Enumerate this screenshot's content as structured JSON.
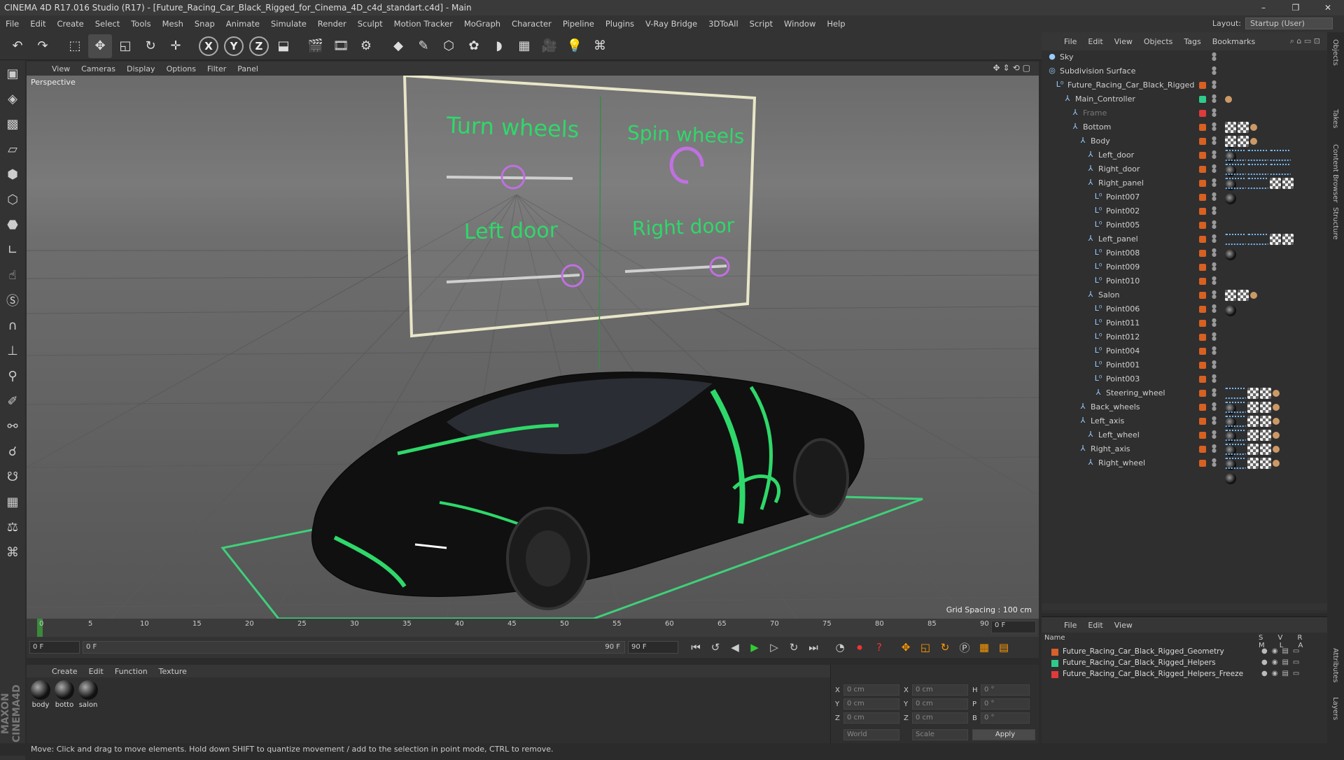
{
  "window": {
    "title": "CINEMA 4D R17.016 Studio (R17) - [Future_Racing_Car_Black_Rigged_for_Cinema_4D_c4d_standart.c4d] - Main"
  },
  "menu": [
    "File",
    "Edit",
    "Create",
    "Select",
    "Tools",
    "Mesh",
    "Snap",
    "Animate",
    "Simulate",
    "Render",
    "Sculpt",
    "Motion Tracker",
    "MoGraph",
    "Character",
    "Pipeline",
    "Plugins",
    "V-Ray Bridge",
    "3DToAll",
    "Script",
    "Window",
    "Help"
  ],
  "layout": {
    "label": "Layout:",
    "value": "Startup (User)"
  },
  "viewport": {
    "menu": [
      "View",
      "Cameras",
      "Display",
      "Options",
      "Filter",
      "Panel"
    ],
    "camera_label": "Perspective",
    "grid_spacing": "Grid Spacing : 100 cm",
    "hud": {
      "turn": "Turn wheels",
      "spin": "Spin wheels",
      "left": "Left door",
      "right": "Right door"
    }
  },
  "timeline": {
    "ticks": [
      "0",
      "5",
      "10",
      "15",
      "20",
      "25",
      "30",
      "35",
      "40",
      "45",
      "50",
      "55",
      "60",
      "65",
      "70",
      "75",
      "80",
      "85",
      "90"
    ],
    "current_frame": "0 F"
  },
  "transport": {
    "start": "0 F",
    "range_start": "0 F",
    "range_end": "90 F",
    "end": "90 F"
  },
  "material_panel": {
    "menu": [
      "Create",
      "Edit",
      "Function",
      "Texture"
    ],
    "materials": [
      "body",
      "botto",
      "salon"
    ]
  },
  "coordinates": {
    "x_pos": "0 cm",
    "y_pos": "0 cm",
    "z_pos": "0 cm",
    "x_size": "0 cm",
    "y_size": "0 cm",
    "z_size": "0 cm",
    "h": "0 °",
    "p": "0 °",
    "b": "0 °",
    "mode": "World",
    "scale": "Scale",
    "apply": "Apply"
  },
  "status": "Move: Click and drag to move elements. Hold down SHIFT to quantize movement / add to the selection in point mode, CTRL to remove.",
  "object_manager": {
    "menu": [
      "File",
      "Edit",
      "View",
      "Objects",
      "Tags",
      "Bookmarks"
    ],
    "objects": [
      {
        "name": "Sky",
        "depth": 0,
        "icon": "sky"
      },
      {
        "name": "Subdivision Surface",
        "depth": 0,
        "icon": "subdiv"
      },
      {
        "name": "Future_Racing_Car_Black_Rigged",
        "depth": 1,
        "icon": "null"
      },
      {
        "name": "Main_Controller",
        "depth": 2,
        "icon": "joint"
      },
      {
        "name": "Frame",
        "depth": 3,
        "icon": "spline"
      },
      {
        "name": "Bottom",
        "depth": 3,
        "icon": "joint"
      },
      {
        "name": "Body",
        "depth": 4,
        "icon": "joint"
      },
      {
        "name": "Left_door",
        "depth": 5,
        "icon": "joint"
      },
      {
        "name": "Right_door",
        "depth": 5,
        "icon": "joint"
      },
      {
        "name": "Right_panel",
        "depth": 5,
        "icon": "joint"
      },
      {
        "name": "Point007",
        "depth": 6,
        "icon": "null"
      },
      {
        "name": "Point002",
        "depth": 6,
        "icon": "null"
      },
      {
        "name": "Point005",
        "depth": 6,
        "icon": "null"
      },
      {
        "name": "Left_panel",
        "depth": 5,
        "icon": "joint"
      },
      {
        "name": "Point008",
        "depth": 6,
        "icon": "null"
      },
      {
        "name": "Point009",
        "depth": 6,
        "icon": "null"
      },
      {
        "name": "Point010",
        "depth": 6,
        "icon": "null"
      },
      {
        "name": "Salon",
        "depth": 5,
        "icon": "joint"
      },
      {
        "name": "Point006",
        "depth": 6,
        "icon": "null"
      },
      {
        "name": "Point011",
        "depth": 6,
        "icon": "null"
      },
      {
        "name": "Point012",
        "depth": 6,
        "icon": "null"
      },
      {
        "name": "Point004",
        "depth": 6,
        "icon": "null"
      },
      {
        "name": "Point001",
        "depth": 6,
        "icon": "null"
      },
      {
        "name": "Point003",
        "depth": 6,
        "icon": "null"
      },
      {
        "name": "Steering_wheel",
        "depth": 6,
        "icon": "joint"
      },
      {
        "name": "Back_wheels",
        "depth": 4,
        "icon": "joint"
      },
      {
        "name": "Left_axis",
        "depth": 4,
        "icon": "joint"
      },
      {
        "name": "Left_wheel",
        "depth": 5,
        "icon": "joint"
      },
      {
        "name": "Right_axis",
        "depth": 4,
        "icon": "joint"
      },
      {
        "name": "Right_wheel",
        "depth": 5,
        "icon": "joint"
      }
    ]
  },
  "layer_manager": {
    "menu": [
      "File",
      "Edit",
      "View"
    ],
    "header": {
      "name": "Name",
      "cols": "S V R M L A"
    },
    "layers": [
      {
        "name": "Future_Racing_Car_Black_Rigged_Geometry",
        "color": "#d8602a"
      },
      {
        "name": "Future_Racing_Car_Black_Rigged_Helpers",
        "color": "#2ecc8a"
      },
      {
        "name": "Future_Racing_Car_Black_Rigged_Helpers_Freeze",
        "color": "#e03a3a"
      }
    ]
  },
  "side_tabs": [
    "Objects",
    "Takes",
    "Content Browser",
    "Structure",
    "Attributes",
    "Layers"
  ],
  "colors": {
    "accent_green": "#2fd86a",
    "hud_purple": "#c070e0",
    "layer_orange": "#d86020"
  }
}
